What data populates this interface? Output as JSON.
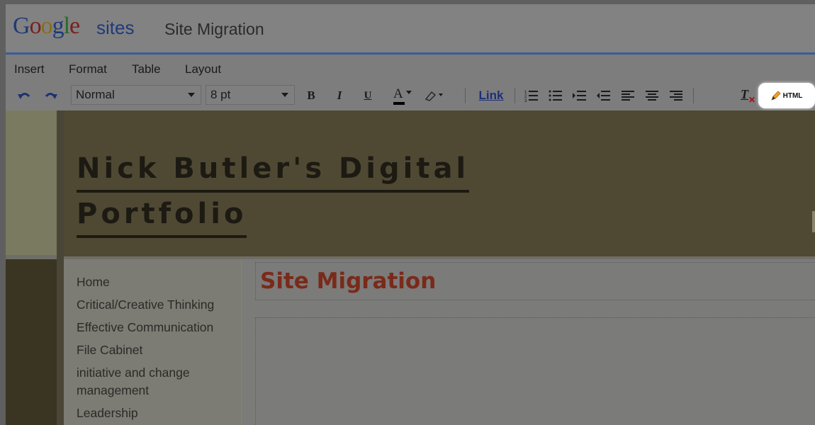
{
  "app": {
    "logo_google": "Google",
    "logo_sites": "sites",
    "site_name": "Site Migration"
  },
  "menu": {
    "items": [
      "Insert",
      "Format",
      "Table",
      "Layout"
    ]
  },
  "toolbar": {
    "style_value": "Normal",
    "size_value": "8 pt",
    "bold": "B",
    "italic": "I",
    "underline": "U",
    "text_color": "A",
    "link": "Link",
    "html": "HTML",
    "remove_format": "T"
  },
  "page": {
    "site_title_line1": "Nick Butler's Digital",
    "site_title_line2": "Portfolio",
    "title": "Site Migration",
    "nav": [
      "Home",
      "Critical/Creative Thinking",
      "Effective Communication",
      "File Cabinet",
      "initiative and change",
      "management",
      "Leadership"
    ]
  },
  "colors": {
    "accent_blue": "#3b5b9a",
    "title_red": "#7a2a1a",
    "link_blue": "#1b2f7a"
  },
  "icons": [
    "undo-icon",
    "redo-icon",
    "highlight-icon",
    "numbered-list-icon",
    "bulleted-list-icon",
    "indent-icon",
    "outdent-icon",
    "align-left-icon",
    "align-center-icon",
    "align-right-icon",
    "remove-formatting-icon",
    "pencil-icon"
  ]
}
